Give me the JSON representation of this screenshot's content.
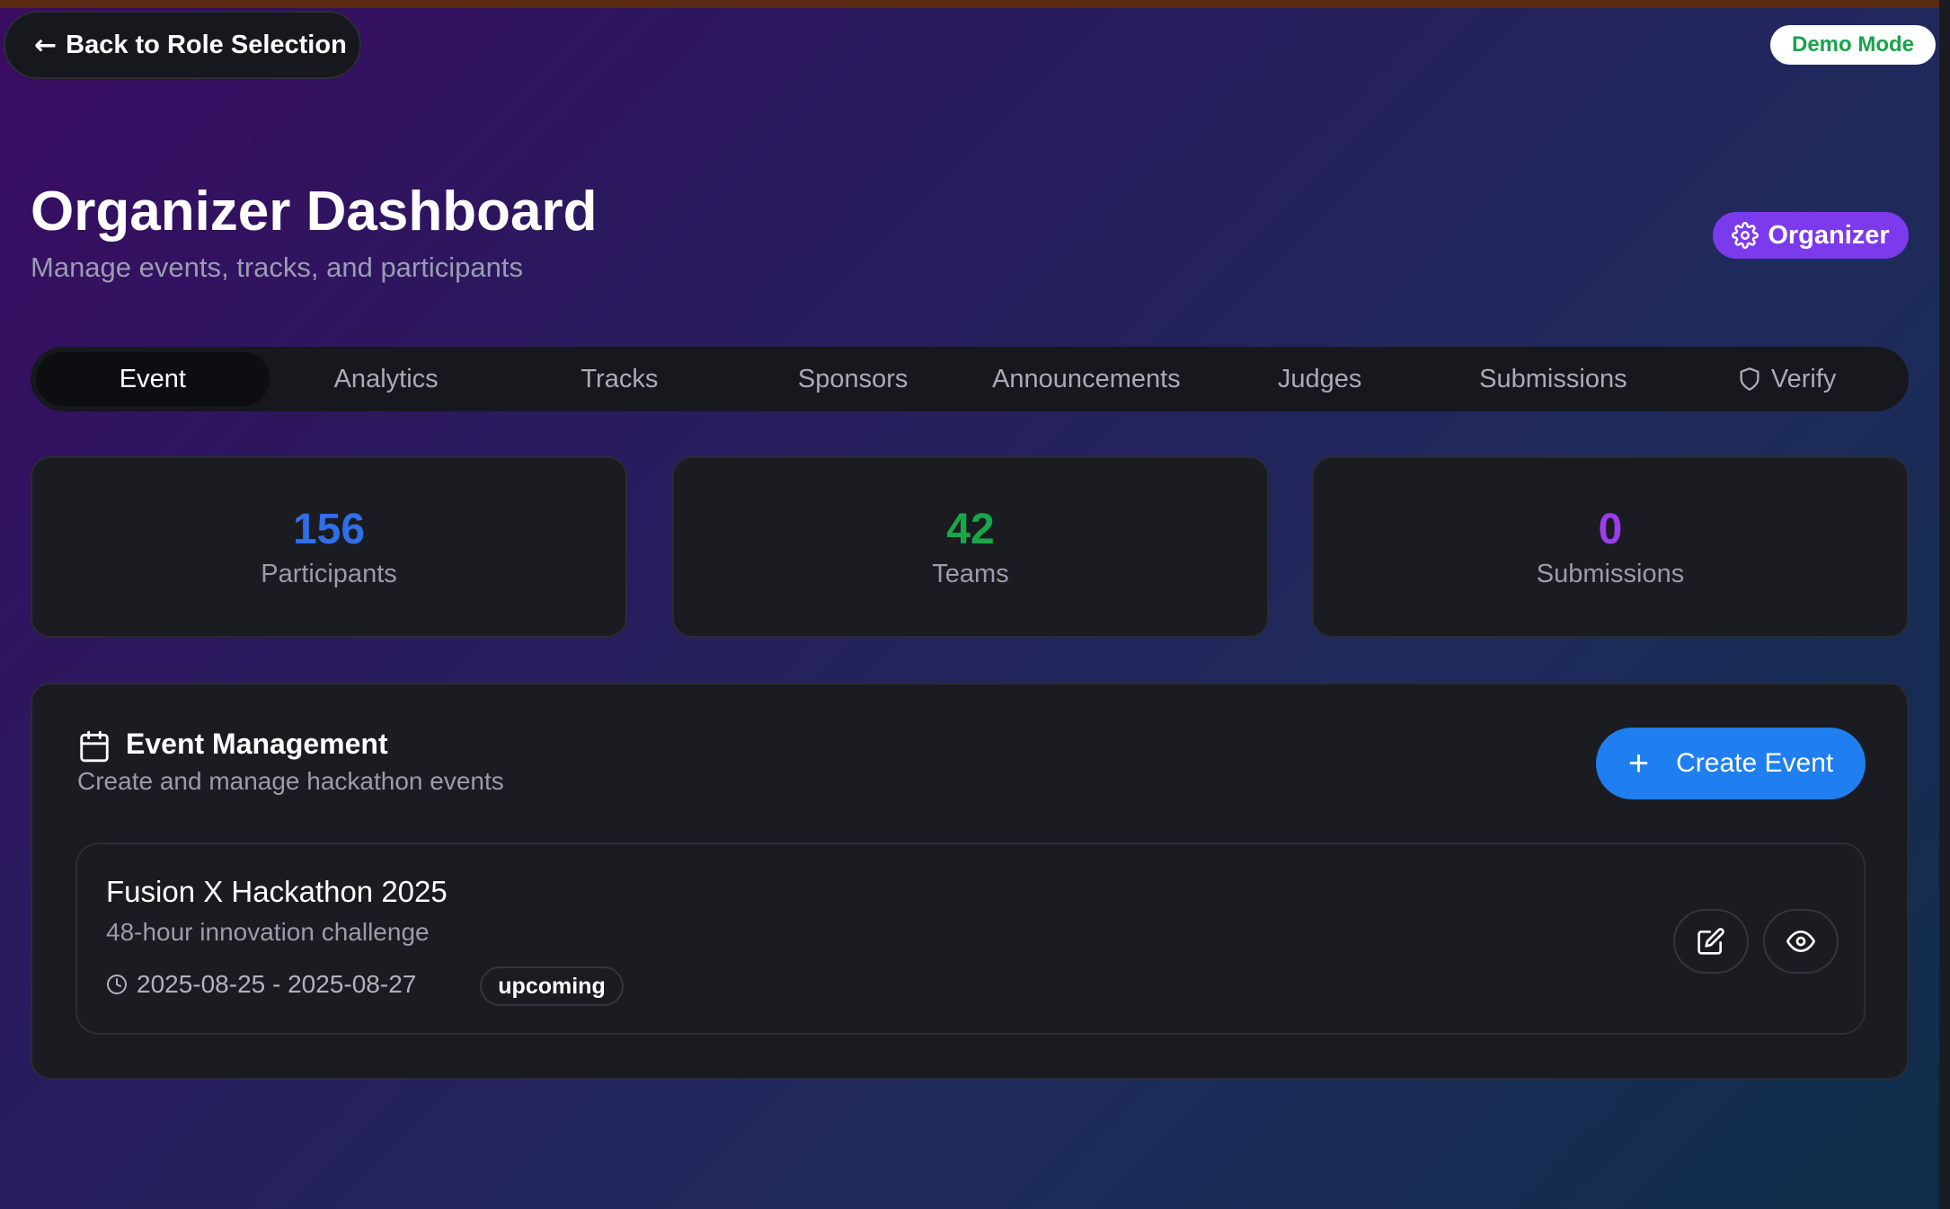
{
  "header": {
    "back_label": "Back to Role Selection",
    "demo_label": "Demo Mode",
    "title": "Organizer Dashboard",
    "subtitle": "Manage events, tracks, and participants",
    "role_label": "Organizer"
  },
  "tabs": [
    {
      "label": "Event",
      "active": true
    },
    {
      "label": "Analytics"
    },
    {
      "label": "Tracks"
    },
    {
      "label": "Sponsors"
    },
    {
      "label": "Announcements"
    },
    {
      "label": "Judges"
    },
    {
      "label": "Submissions"
    },
    {
      "label": "Verify",
      "icon": "shield-icon"
    }
  ],
  "stats": [
    {
      "value": "156",
      "label": "Participants",
      "color": "#2f6fe8"
    },
    {
      "value": "42",
      "label": "Teams",
      "color": "#17a84a"
    },
    {
      "value": "0",
      "label": "Submissions",
      "color": "#9b3ded"
    }
  ],
  "event_management": {
    "title": "Event Management",
    "subtitle": "Create and manage hackathon events",
    "create_label": "Create Event",
    "events": [
      {
        "name": "Fusion X Hackathon 2025",
        "description": "48-hour innovation challenge",
        "dates": "2025-08-25 - 2025-08-27",
        "status": "upcoming"
      }
    ]
  },
  "colors": {
    "accent_blue": "#1f7ef0",
    "role_purple": "#7c3aed",
    "demo_green": "#18a34a"
  }
}
